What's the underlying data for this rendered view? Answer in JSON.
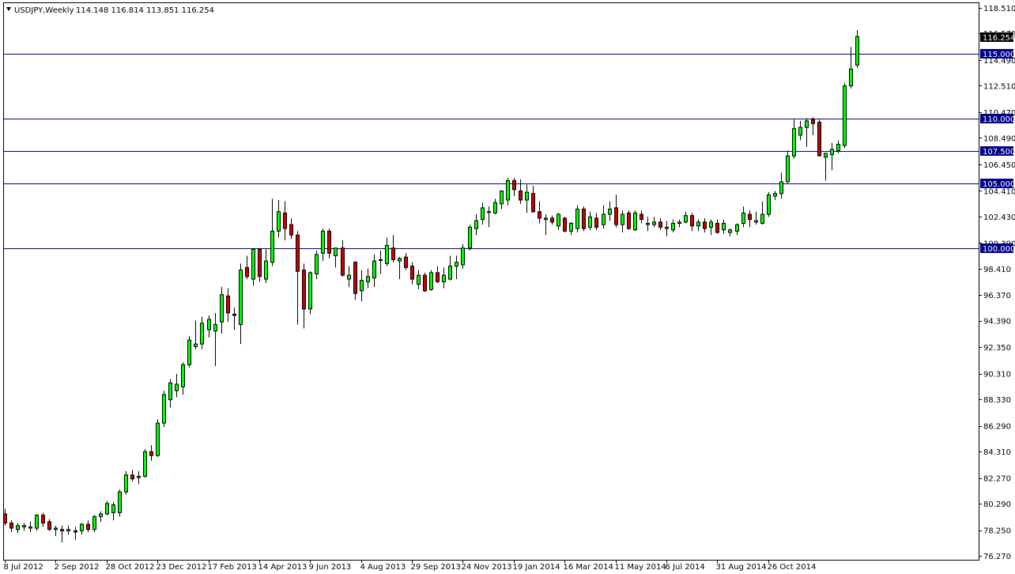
{
  "header": {
    "symbol": "USDJPY,Weekly",
    "ohlc": "114.148 116.814 113.851 116.254",
    "menu_icon": "triangle-down-icon"
  },
  "colors": {
    "bull": "#00ff00",
    "bear": "#cc0000",
    "wick": "#000000",
    "level_line": "#00008b",
    "level_box": "#00008b",
    "price_box": "#000000",
    "background": "#ffffff"
  },
  "chart_data": {
    "type": "candlestick",
    "title": "",
    "ylim": [
      76.27,
      118.51
    ],
    "grid": false,
    "y_ticks": [
      "118.510",
      "116.570",
      "114.490",
      "112.510",
      "110.470",
      "108.490",
      "106.450",
      "104.410",
      "102.430",
      "100.390",
      "98.410",
      "96.370",
      "94.390",
      "92.350",
      "90.310",
      "88.330",
      "86.290",
      "84.310",
      "82.270",
      "80.290",
      "78.250",
      "76.270"
    ],
    "x_ticks": [
      "8 Jul 2012",
      "2 Sep 2012",
      "28 Oct 2012",
      "23 Dec 2012",
      "17 Feb 2013",
      "14 Apr 2013",
      "9 Jun 2013",
      "4 Aug 2013",
      "29 Sep 2013",
      "24 Nov 2013",
      "19 Jan 2014",
      "16 Mar 2014",
      "11 May 2014",
      "6 Jul 2014",
      "31 Aug 2014",
      "26 Oct 2014"
    ],
    "horizontal_levels": [
      {
        "value": 115.0,
        "label": "115.000"
      },
      {
        "value": 110.0,
        "label": "110.000"
      },
      {
        "value": 107.5,
        "label": "107.500"
      },
      {
        "value": 105.0,
        "label": "105.000"
      },
      {
        "value": 100.0,
        "label": "100.000"
      }
    ],
    "last_price": {
      "value": 116.254,
      "label": "116.254"
    },
    "candles": [
      {
        "o": 79.5,
        "h": 79.9,
        "l": 78.6,
        "c": 78.8
      },
      {
        "o": 78.8,
        "h": 79.0,
        "l": 78.1,
        "c": 78.4
      },
      {
        "o": 78.3,
        "h": 78.8,
        "l": 78.0,
        "c": 78.6
      },
      {
        "o": 78.5,
        "h": 78.8,
        "l": 78.2,
        "c": 78.6
      },
      {
        "o": 78.4,
        "h": 78.9,
        "l": 78.1,
        "c": 78.5
      },
      {
        "o": 78.4,
        "h": 79.5,
        "l": 78.2,
        "c": 79.4
      },
      {
        "o": 79.4,
        "h": 79.6,
        "l": 78.5,
        "c": 78.8
      },
      {
        "o": 78.9,
        "h": 79.1,
        "l": 78.2,
        "c": 78.3
      },
      {
        "o": 78.3,
        "h": 78.6,
        "l": 77.8,
        "c": 78.4
      },
      {
        "o": 78.3,
        "h": 78.6,
        "l": 77.3,
        "c": 78.2
      },
      {
        "o": 78.2,
        "h": 78.6,
        "l": 77.9,
        "c": 78.3
      },
      {
        "o": 78.2,
        "h": 78.5,
        "l": 77.5,
        "c": 78.1
      },
      {
        "o": 78.2,
        "h": 78.8,
        "l": 77.9,
        "c": 78.7
      },
      {
        "o": 78.7,
        "h": 79.0,
        "l": 78.1,
        "c": 78.3
      },
      {
        "o": 78.3,
        "h": 79.4,
        "l": 78.1,
        "c": 79.3
      },
      {
        "o": 79.3,
        "h": 79.7,
        "l": 78.9,
        "c": 79.5
      },
      {
        "o": 79.5,
        "h": 80.5,
        "l": 79.4,
        "c": 80.3
      },
      {
        "o": 79.6,
        "h": 80.4,
        "l": 79.0,
        "c": 80.2
      },
      {
        "o": 79.6,
        "h": 81.4,
        "l": 79.3,
        "c": 81.2
      },
      {
        "o": 81.2,
        "h": 82.8,
        "l": 81.0,
        "c": 82.5
      },
      {
        "o": 82.5,
        "h": 82.9,
        "l": 82.0,
        "c": 82.2
      },
      {
        "o": 82.3,
        "h": 82.8,
        "l": 81.8,
        "c": 82.4
      },
      {
        "o": 82.4,
        "h": 84.5,
        "l": 82.3,
        "c": 84.3
      },
      {
        "o": 84.3,
        "h": 84.8,
        "l": 83.6,
        "c": 84.0
      },
      {
        "o": 84.0,
        "h": 86.8,
        "l": 83.9,
        "c": 86.5
      },
      {
        "o": 86.5,
        "h": 89.0,
        "l": 86.2,
        "c": 88.7
      },
      {
        "o": 88.3,
        "h": 89.9,
        "l": 87.7,
        "c": 89.6
      },
      {
        "o": 89.0,
        "h": 90.3,
        "l": 88.5,
        "c": 89.5
      },
      {
        "o": 89.3,
        "h": 91.2,
        "l": 88.7,
        "c": 91.0
      },
      {
        "o": 91.0,
        "h": 93.2,
        "l": 90.8,
        "c": 92.9
      },
      {
        "o": 92.4,
        "h": 94.4,
        "l": 92.2,
        "c": 92.6
      },
      {
        "o": 92.6,
        "h": 94.7,
        "l": 92.2,
        "c": 94.2
      },
      {
        "o": 93.7,
        "h": 94.8,
        "l": 93.1,
        "c": 94.5
      },
      {
        "o": 93.6,
        "h": 95.0,
        "l": 90.9,
        "c": 94.1
      },
      {
        "o": 94.3,
        "h": 97.0,
        "l": 93.4,
        "c": 96.4
      },
      {
        "o": 96.3,
        "h": 96.9,
        "l": 94.3,
        "c": 95.0
      },
      {
        "o": 94.9,
        "h": 95.4,
        "l": 93.7,
        "c": 94.8
      },
      {
        "o": 94.1,
        "h": 98.8,
        "l": 92.6,
        "c": 98.3
      },
      {
        "o": 98.5,
        "h": 99.4,
        "l": 97.6,
        "c": 97.8
      },
      {
        "o": 97.6,
        "h": 100.0,
        "l": 97.1,
        "c": 99.9
      },
      {
        "o": 99.9,
        "h": 100.0,
        "l": 97.4,
        "c": 97.8
      },
      {
        "o": 97.6,
        "h": 99.9,
        "l": 97.3,
        "c": 99.0
      },
      {
        "o": 98.9,
        "h": 103.8,
        "l": 98.6,
        "c": 101.3
      },
      {
        "o": 101.3,
        "h": 103.7,
        "l": 100.8,
        "c": 102.8
      },
      {
        "o": 102.7,
        "h": 103.6,
        "l": 100.6,
        "c": 101.5
      },
      {
        "o": 101.8,
        "h": 102.3,
        "l": 100.7,
        "c": 101.0
      },
      {
        "o": 101.0,
        "h": 101.3,
        "l": 94.1,
        "c": 98.2
      },
      {
        "o": 98.3,
        "h": 98.8,
        "l": 93.8,
        "c": 95.3
      },
      {
        "o": 95.3,
        "h": 98.2,
        "l": 94.9,
        "c": 98.1
      },
      {
        "o": 98.0,
        "h": 99.8,
        "l": 97.6,
        "c": 99.5
      },
      {
        "o": 99.6,
        "h": 101.5,
        "l": 99.0,
        "c": 101.3
      },
      {
        "o": 101.3,
        "h": 101.5,
        "l": 99.2,
        "c": 99.6
      },
      {
        "o": 99.4,
        "h": 100.0,
        "l": 98.5,
        "c": 100.0
      },
      {
        "o": 100.0,
        "h": 100.6,
        "l": 97.8,
        "c": 97.9
      },
      {
        "o": 97.6,
        "h": 98.6,
        "l": 97.0,
        "c": 97.9
      },
      {
        "o": 98.9,
        "h": 99.0,
        "l": 96.0,
        "c": 96.5
      },
      {
        "o": 96.7,
        "h": 98.3,
        "l": 95.9,
        "c": 97.5
      },
      {
        "o": 97.4,
        "h": 98.4,
        "l": 96.9,
        "c": 97.8
      },
      {
        "o": 97.7,
        "h": 99.5,
        "l": 97.0,
        "c": 99.0
      },
      {
        "o": 99.1,
        "h": 99.8,
        "l": 98.0,
        "c": 99.1
      },
      {
        "o": 98.8,
        "h": 100.8,
        "l": 98.6,
        "c": 100.2
      },
      {
        "o": 100.0,
        "h": 101.0,
        "l": 98.9,
        "c": 99.1
      },
      {
        "o": 99.0,
        "h": 99.3,
        "l": 97.6,
        "c": 99.2
      },
      {
        "o": 99.3,
        "h": 99.6,
        "l": 98.3,
        "c": 98.5
      },
      {
        "o": 98.6,
        "h": 98.9,
        "l": 97.2,
        "c": 97.6
      },
      {
        "o": 97.2,
        "h": 98.3,
        "l": 96.8,
        "c": 97.9
      },
      {
        "o": 97.9,
        "h": 98.1,
        "l": 96.6,
        "c": 96.7
      },
      {
        "o": 96.8,
        "h": 98.3,
        "l": 96.7,
        "c": 98.1
      },
      {
        "o": 98.1,
        "h": 98.6,
        "l": 97.3,
        "c": 97.4
      },
      {
        "o": 97.4,
        "h": 98.5,
        "l": 96.9,
        "c": 97.9
      },
      {
        "o": 97.6,
        "h": 99.4,
        "l": 97.5,
        "c": 98.6
      },
      {
        "o": 98.6,
        "h": 99.4,
        "l": 97.6,
        "c": 98.9
      },
      {
        "o": 98.7,
        "h": 100.3,
        "l": 98.4,
        "c": 100.0
      },
      {
        "o": 100.0,
        "h": 101.8,
        "l": 99.8,
        "c": 101.6
      },
      {
        "o": 101.5,
        "h": 102.6,
        "l": 101.0,
        "c": 102.1
      },
      {
        "o": 102.2,
        "h": 103.5,
        "l": 101.8,
        "c": 103.1
      },
      {
        "o": 102.8,
        "h": 103.2,
        "l": 101.6,
        "c": 102.8
      },
      {
        "o": 102.7,
        "h": 103.8,
        "l": 102.6,
        "c": 103.5
      },
      {
        "o": 103.4,
        "h": 104.0,
        "l": 103.0,
        "c": 104.4
      },
      {
        "o": 103.7,
        "h": 105.4,
        "l": 103.3,
        "c": 105.2
      },
      {
        "o": 105.2,
        "h": 105.4,
        "l": 104.0,
        "c": 104.5
      },
      {
        "o": 104.4,
        "h": 105.3,
        "l": 103.4,
        "c": 103.7
      },
      {
        "o": 103.7,
        "h": 104.9,
        "l": 102.7,
        "c": 104.3
      },
      {
        "o": 104.2,
        "h": 104.8,
        "l": 102.7,
        "c": 102.8
      },
      {
        "o": 102.8,
        "h": 103.6,
        "l": 101.9,
        "c": 102.3
      },
      {
        "o": 102.2,
        "h": 102.6,
        "l": 101.0,
        "c": 102.3
      },
      {
        "o": 102.3,
        "h": 102.5,
        "l": 101.8,
        "c": 102.0
      },
      {
        "o": 101.7,
        "h": 102.7,
        "l": 101.4,
        "c": 102.6
      },
      {
        "o": 102.3,
        "h": 102.4,
        "l": 101.2,
        "c": 101.3
      },
      {
        "o": 101.3,
        "h": 102.0,
        "l": 101.0,
        "c": 101.9
      },
      {
        "o": 101.5,
        "h": 103.3,
        "l": 101.2,
        "c": 103.0
      },
      {
        "o": 103.0,
        "h": 103.2,
        "l": 101.3,
        "c": 101.5
      },
      {
        "o": 101.6,
        "h": 102.8,
        "l": 101.4,
        "c": 102.4
      },
      {
        "o": 102.3,
        "h": 102.7,
        "l": 101.4,
        "c": 101.6
      },
      {
        "o": 101.8,
        "h": 103.3,
        "l": 101.5,
        "c": 102.6
      },
      {
        "o": 102.6,
        "h": 103.6,
        "l": 102.1,
        "c": 103.0
      },
      {
        "o": 103.1,
        "h": 104.1,
        "l": 101.6,
        "c": 101.8
      },
      {
        "o": 101.8,
        "h": 102.9,
        "l": 101.2,
        "c": 102.6
      },
      {
        "o": 102.7,
        "h": 102.9,
        "l": 101.4,
        "c": 101.5
      },
      {
        "o": 101.4,
        "h": 102.9,
        "l": 101.3,
        "c": 102.7
      },
      {
        "o": 102.6,
        "h": 102.9,
        "l": 101.9,
        "c": 102.2
      },
      {
        "o": 101.8,
        "h": 102.4,
        "l": 101.3,
        "c": 101.9
      },
      {
        "o": 101.8,
        "h": 102.4,
        "l": 101.6,
        "c": 102.0
      },
      {
        "o": 102.0,
        "h": 102.3,
        "l": 101.4,
        "c": 101.6
      },
      {
        "o": 101.5,
        "h": 102.1,
        "l": 100.9,
        "c": 101.6
      },
      {
        "o": 101.4,
        "h": 102.2,
        "l": 101.2,
        "c": 101.9
      },
      {
        "o": 101.9,
        "h": 102.2,
        "l": 101.6,
        "c": 102.0
      },
      {
        "o": 102.0,
        "h": 102.8,
        "l": 101.9,
        "c": 102.5
      },
      {
        "o": 102.5,
        "h": 102.7,
        "l": 101.3,
        "c": 101.7
      },
      {
        "o": 101.7,
        "h": 102.2,
        "l": 101.3,
        "c": 102.0
      },
      {
        "o": 102.0,
        "h": 102.3,
        "l": 101.2,
        "c": 101.5
      },
      {
        "o": 101.6,
        "h": 102.2,
        "l": 101.0,
        "c": 102.0
      },
      {
        "o": 101.9,
        "h": 102.2,
        "l": 101.1,
        "c": 101.2
      },
      {
        "o": 101.4,
        "h": 102.2,
        "l": 101.1,
        "c": 101.9
      },
      {
        "o": 101.2,
        "h": 101.5,
        "l": 100.9,
        "c": 101.4
      },
      {
        "o": 101.3,
        "h": 101.9,
        "l": 101.0,
        "c": 101.8
      },
      {
        "o": 101.9,
        "h": 103.2,
        "l": 101.6,
        "c": 102.7
      },
      {
        "o": 102.6,
        "h": 102.9,
        "l": 101.6,
        "c": 102.2
      },
      {
        "o": 102.0,
        "h": 102.8,
        "l": 101.8,
        "c": 102.1
      },
      {
        "o": 101.9,
        "h": 103.6,
        "l": 101.8,
        "c": 102.6
      },
      {
        "o": 102.6,
        "h": 104.3,
        "l": 102.4,
        "c": 104.1
      },
      {
        "o": 104.0,
        "h": 104.4,
        "l": 103.7,
        "c": 104.2
      },
      {
        "o": 104.2,
        "h": 105.8,
        "l": 103.8,
        "c": 105.1
      },
      {
        "o": 105.1,
        "h": 107.5,
        "l": 105.0,
        "c": 107.1
      },
      {
        "o": 107.1,
        "h": 109.9,
        "l": 106.9,
        "c": 109.2
      },
      {
        "o": 108.7,
        "h": 109.8,
        "l": 108.3,
        "c": 109.3
      },
      {
        "o": 109.3,
        "h": 110.0,
        "l": 107.8,
        "c": 109.8
      },
      {
        "o": 109.9,
        "h": 110.1,
        "l": 108.7,
        "c": 109.6
      },
      {
        "o": 109.7,
        "h": 109.9,
        "l": 107.6,
        "c": 107.1
      },
      {
        "o": 107.0,
        "h": 107.2,
        "l": 105.2,
        "c": 107.3
      },
      {
        "o": 107.2,
        "h": 108.1,
        "l": 106.0,
        "c": 107.6
      },
      {
        "o": 107.5,
        "h": 108.3,
        "l": 107.3,
        "c": 108.0
      },
      {
        "o": 107.9,
        "h": 112.7,
        "l": 107.7,
        "c": 112.5
      },
      {
        "o": 112.5,
        "h": 115.5,
        "l": 112.3,
        "c": 113.8
      },
      {
        "o": 114.1,
        "h": 116.8,
        "l": 113.9,
        "c": 116.3
      }
    ]
  }
}
